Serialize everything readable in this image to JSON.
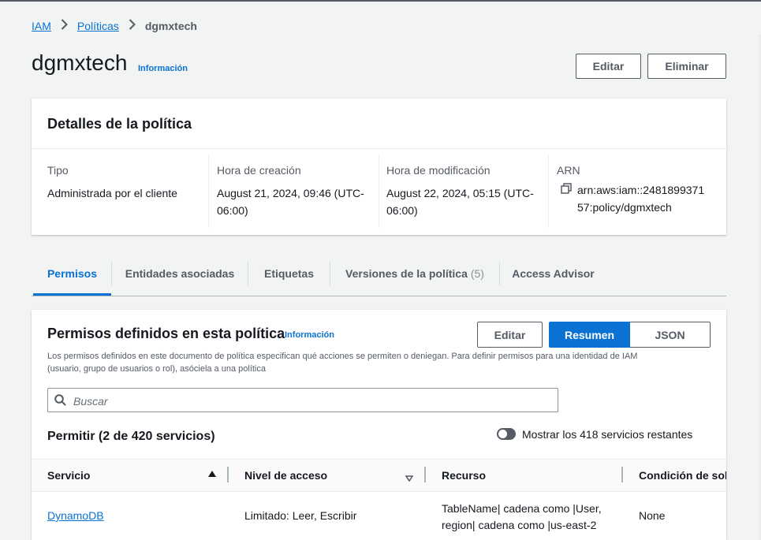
{
  "breadcrumb": {
    "items": [
      "IAM",
      "Políticas"
    ],
    "current": "dgmxtech"
  },
  "header": {
    "title": "dgmxtech",
    "info": "Información",
    "edit": "Editar",
    "delete": "Eliminar"
  },
  "details": {
    "title": "Detalles de la política",
    "type_label": "Tipo",
    "type_value": "Administrada por el cliente",
    "created_label": "Hora de creación",
    "created_line1": "August 21, 2024, 09:46 (UTC-",
    "created_line2": "06:00)",
    "modified_label": "Hora de modificación",
    "modified_line1": "August 22, 2024, 05:15 (UTC-",
    "modified_line2": "06:00)",
    "arn_label": "ARN",
    "arn_line1": "arn:aws:iam::2481899371",
    "arn_line2": "57:policy/dgmxtech"
  },
  "tabs": [
    {
      "label": "Permisos"
    },
    {
      "label": "Entidades asociadas"
    },
    {
      "label": "Etiquetas"
    },
    {
      "label": "Versiones de la política",
      "count": "(5)"
    },
    {
      "label": "Access Advisor"
    }
  ],
  "permissions": {
    "title": "Permisos definidos en esta política",
    "info": "Información",
    "description_line1": "Los permisos definidos en este documento de política especifican qué acciones se permiten o deniegan. Para definir permisos para una identidad de IAM",
    "description_line2": "(usuario, grupo de usuarios o rol), asóciela a una política",
    "edit": "Editar",
    "summary": "Resumen",
    "json": "JSON",
    "search_placeholder": "Buscar",
    "allow_heading": "Permitir (2 de 420 servicios)",
    "toggle_label": "Mostrar los 418 servicios restantes",
    "columns": [
      "Servicio",
      "Nivel de acceso",
      "Recurso",
      "Condición de soli"
    ],
    "rows": [
      {
        "service": "DynamoDB",
        "access": "Limitado: Leer, Escribir",
        "resource_line1": "TableName| cadena como |User,",
        "resource_line2": "region| cadena como |us-east-2",
        "condition": "None"
      }
    ]
  },
  "colors": {
    "accent": "#0972d3",
    "text": "#16191f",
    "muted": "#545b64"
  }
}
